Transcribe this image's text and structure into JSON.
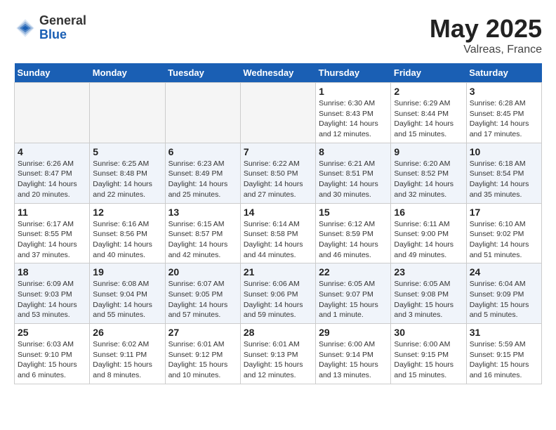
{
  "logo": {
    "general": "General",
    "blue": "Blue"
  },
  "title": {
    "month_year": "May 2025",
    "location": "Valreas, France"
  },
  "headers": [
    "Sunday",
    "Monday",
    "Tuesday",
    "Wednesday",
    "Thursday",
    "Friday",
    "Saturday"
  ],
  "weeks": [
    [
      {
        "day": "",
        "info": ""
      },
      {
        "day": "",
        "info": ""
      },
      {
        "day": "",
        "info": ""
      },
      {
        "day": "",
        "info": ""
      },
      {
        "day": "1",
        "info": "Sunrise: 6:30 AM\nSunset: 8:43 PM\nDaylight: 14 hours\nand 12 minutes."
      },
      {
        "day": "2",
        "info": "Sunrise: 6:29 AM\nSunset: 8:44 PM\nDaylight: 14 hours\nand 15 minutes."
      },
      {
        "day": "3",
        "info": "Sunrise: 6:28 AM\nSunset: 8:45 PM\nDaylight: 14 hours\nand 17 minutes."
      }
    ],
    [
      {
        "day": "4",
        "info": "Sunrise: 6:26 AM\nSunset: 8:47 PM\nDaylight: 14 hours\nand 20 minutes."
      },
      {
        "day": "5",
        "info": "Sunrise: 6:25 AM\nSunset: 8:48 PM\nDaylight: 14 hours\nand 22 minutes."
      },
      {
        "day": "6",
        "info": "Sunrise: 6:23 AM\nSunset: 8:49 PM\nDaylight: 14 hours\nand 25 minutes."
      },
      {
        "day": "7",
        "info": "Sunrise: 6:22 AM\nSunset: 8:50 PM\nDaylight: 14 hours\nand 27 minutes."
      },
      {
        "day": "8",
        "info": "Sunrise: 6:21 AM\nSunset: 8:51 PM\nDaylight: 14 hours\nand 30 minutes."
      },
      {
        "day": "9",
        "info": "Sunrise: 6:20 AM\nSunset: 8:52 PM\nDaylight: 14 hours\nand 32 minutes."
      },
      {
        "day": "10",
        "info": "Sunrise: 6:18 AM\nSunset: 8:54 PM\nDaylight: 14 hours\nand 35 minutes."
      }
    ],
    [
      {
        "day": "11",
        "info": "Sunrise: 6:17 AM\nSunset: 8:55 PM\nDaylight: 14 hours\nand 37 minutes."
      },
      {
        "day": "12",
        "info": "Sunrise: 6:16 AM\nSunset: 8:56 PM\nDaylight: 14 hours\nand 40 minutes."
      },
      {
        "day": "13",
        "info": "Sunrise: 6:15 AM\nSunset: 8:57 PM\nDaylight: 14 hours\nand 42 minutes."
      },
      {
        "day": "14",
        "info": "Sunrise: 6:14 AM\nSunset: 8:58 PM\nDaylight: 14 hours\nand 44 minutes."
      },
      {
        "day": "15",
        "info": "Sunrise: 6:12 AM\nSunset: 8:59 PM\nDaylight: 14 hours\nand 46 minutes."
      },
      {
        "day": "16",
        "info": "Sunrise: 6:11 AM\nSunset: 9:00 PM\nDaylight: 14 hours\nand 49 minutes."
      },
      {
        "day": "17",
        "info": "Sunrise: 6:10 AM\nSunset: 9:02 PM\nDaylight: 14 hours\nand 51 minutes."
      }
    ],
    [
      {
        "day": "18",
        "info": "Sunrise: 6:09 AM\nSunset: 9:03 PM\nDaylight: 14 hours\nand 53 minutes."
      },
      {
        "day": "19",
        "info": "Sunrise: 6:08 AM\nSunset: 9:04 PM\nDaylight: 14 hours\nand 55 minutes."
      },
      {
        "day": "20",
        "info": "Sunrise: 6:07 AM\nSunset: 9:05 PM\nDaylight: 14 hours\nand 57 minutes."
      },
      {
        "day": "21",
        "info": "Sunrise: 6:06 AM\nSunset: 9:06 PM\nDaylight: 14 hours\nand 59 minutes."
      },
      {
        "day": "22",
        "info": "Sunrise: 6:05 AM\nSunset: 9:07 PM\nDaylight: 15 hours\nand 1 minute."
      },
      {
        "day": "23",
        "info": "Sunrise: 6:05 AM\nSunset: 9:08 PM\nDaylight: 15 hours\nand 3 minutes."
      },
      {
        "day": "24",
        "info": "Sunrise: 6:04 AM\nSunset: 9:09 PM\nDaylight: 15 hours\nand 5 minutes."
      }
    ],
    [
      {
        "day": "25",
        "info": "Sunrise: 6:03 AM\nSunset: 9:10 PM\nDaylight: 15 hours\nand 6 minutes."
      },
      {
        "day": "26",
        "info": "Sunrise: 6:02 AM\nSunset: 9:11 PM\nDaylight: 15 hours\nand 8 minutes."
      },
      {
        "day": "27",
        "info": "Sunrise: 6:01 AM\nSunset: 9:12 PM\nDaylight: 15 hours\nand 10 minutes."
      },
      {
        "day": "28",
        "info": "Sunrise: 6:01 AM\nSunset: 9:13 PM\nDaylight: 15 hours\nand 12 minutes."
      },
      {
        "day": "29",
        "info": "Sunrise: 6:00 AM\nSunset: 9:14 PM\nDaylight: 15 hours\nand 13 minutes."
      },
      {
        "day": "30",
        "info": "Sunrise: 6:00 AM\nSunset: 9:15 PM\nDaylight: 15 hours\nand 15 minutes."
      },
      {
        "day": "31",
        "info": "Sunrise: 5:59 AM\nSunset: 9:15 PM\nDaylight: 15 hours\nand 16 minutes."
      }
    ]
  ]
}
